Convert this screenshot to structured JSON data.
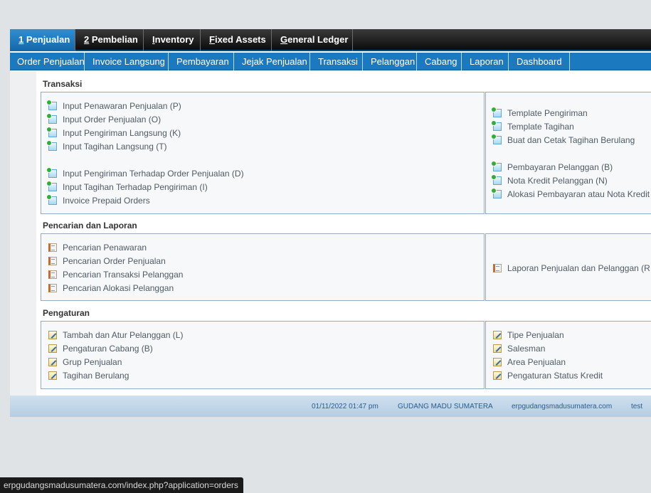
{
  "top_tabs": [
    {
      "key": "1",
      "rest": " Penjualan"
    },
    {
      "key": "2",
      "rest": " Pembelian"
    },
    {
      "key": "I",
      "rest": "nventory"
    },
    {
      "key": "F",
      "rest": "ixed Assets"
    },
    {
      "key": "G",
      "rest": "eneral Ledger"
    }
  ],
  "sub_tabs": [
    "Order Penjualan",
    "Invoice Langsung",
    "Pembayaran",
    "Jejak Penjualan",
    "Transaksi",
    "Pelanggan",
    "Cabang",
    "Laporan",
    "Dashboard"
  ],
  "sections": {
    "transaksi": {
      "title": "Transaksi",
      "left": [
        "Input Penawaran Penjualan (P)",
        "Input Order Penjualan (O)",
        "Input Pengiriman Langsung (K)",
        "Input Tagihan Langsung (T)",
        "Input Pengiriman Terhadap Order Penjualan (D)",
        "Input Tagihan Terhadap Pengiriman (I)",
        "Invoice Prepaid Orders"
      ],
      "right": [
        "Template Pengiriman",
        "Template Tagihan",
        "Buat dan Cetak Tagihan Berulang",
        "Pembayaran Pelanggan (B)",
        "Nota Kredit Pelanggan (N)",
        "Alokasi Pembayaran atau Nota Kredit"
      ]
    },
    "pencarian": {
      "title": "Pencarian dan Laporan",
      "left": [
        "Pencarian Penawaran",
        "Pencarian Order Penjualan",
        "Pencarian Transaksi Pelanggan",
        "Pencarian Alokasi Pelanggan"
      ],
      "right": [
        "Laporan Penjualan dan Pelanggan (R"
      ]
    },
    "pengaturan": {
      "title": "Pengaturan",
      "left": [
        "Tambah dan Atur Pelanggan (L)",
        "Pengaturan Cabang (B)",
        "Grup Penjualan",
        "Tagihan Berulang"
      ],
      "right": [
        "Tipe Penjualan",
        "Salesman",
        "Area Penjualan",
        "Pengaturan Status Kredit"
      ]
    }
  },
  "footer": {
    "datetime": "01/11/2022 01:47 pm",
    "company": "GUDANG MADU SUMATERA",
    "domain": "erpgudangsmadusumatera.com",
    "user": "test"
  },
  "status_url": "erpgudangsmadusumatera.com/index.php?application=orders"
}
